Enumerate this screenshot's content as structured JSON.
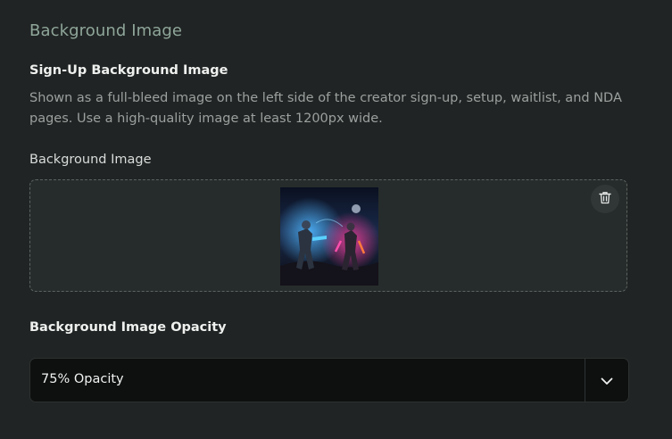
{
  "section": {
    "title": "Background Image"
  },
  "signup": {
    "title": "Sign-Up Background Image",
    "description": "Shown as a full-bleed image on the left side of the creator sign-up, setup, waitlist, and NDA pages. Use a high-quality image at least 1200px wide."
  },
  "upload": {
    "label": "Background Image",
    "preview_subject": "sci-fi armored warriors with glowing weapons",
    "delete_icon": "trash-icon"
  },
  "opacity": {
    "label": "Background Image Opacity",
    "selected": "75% Opacity",
    "chevron_icon": "chevron-down-icon"
  }
}
